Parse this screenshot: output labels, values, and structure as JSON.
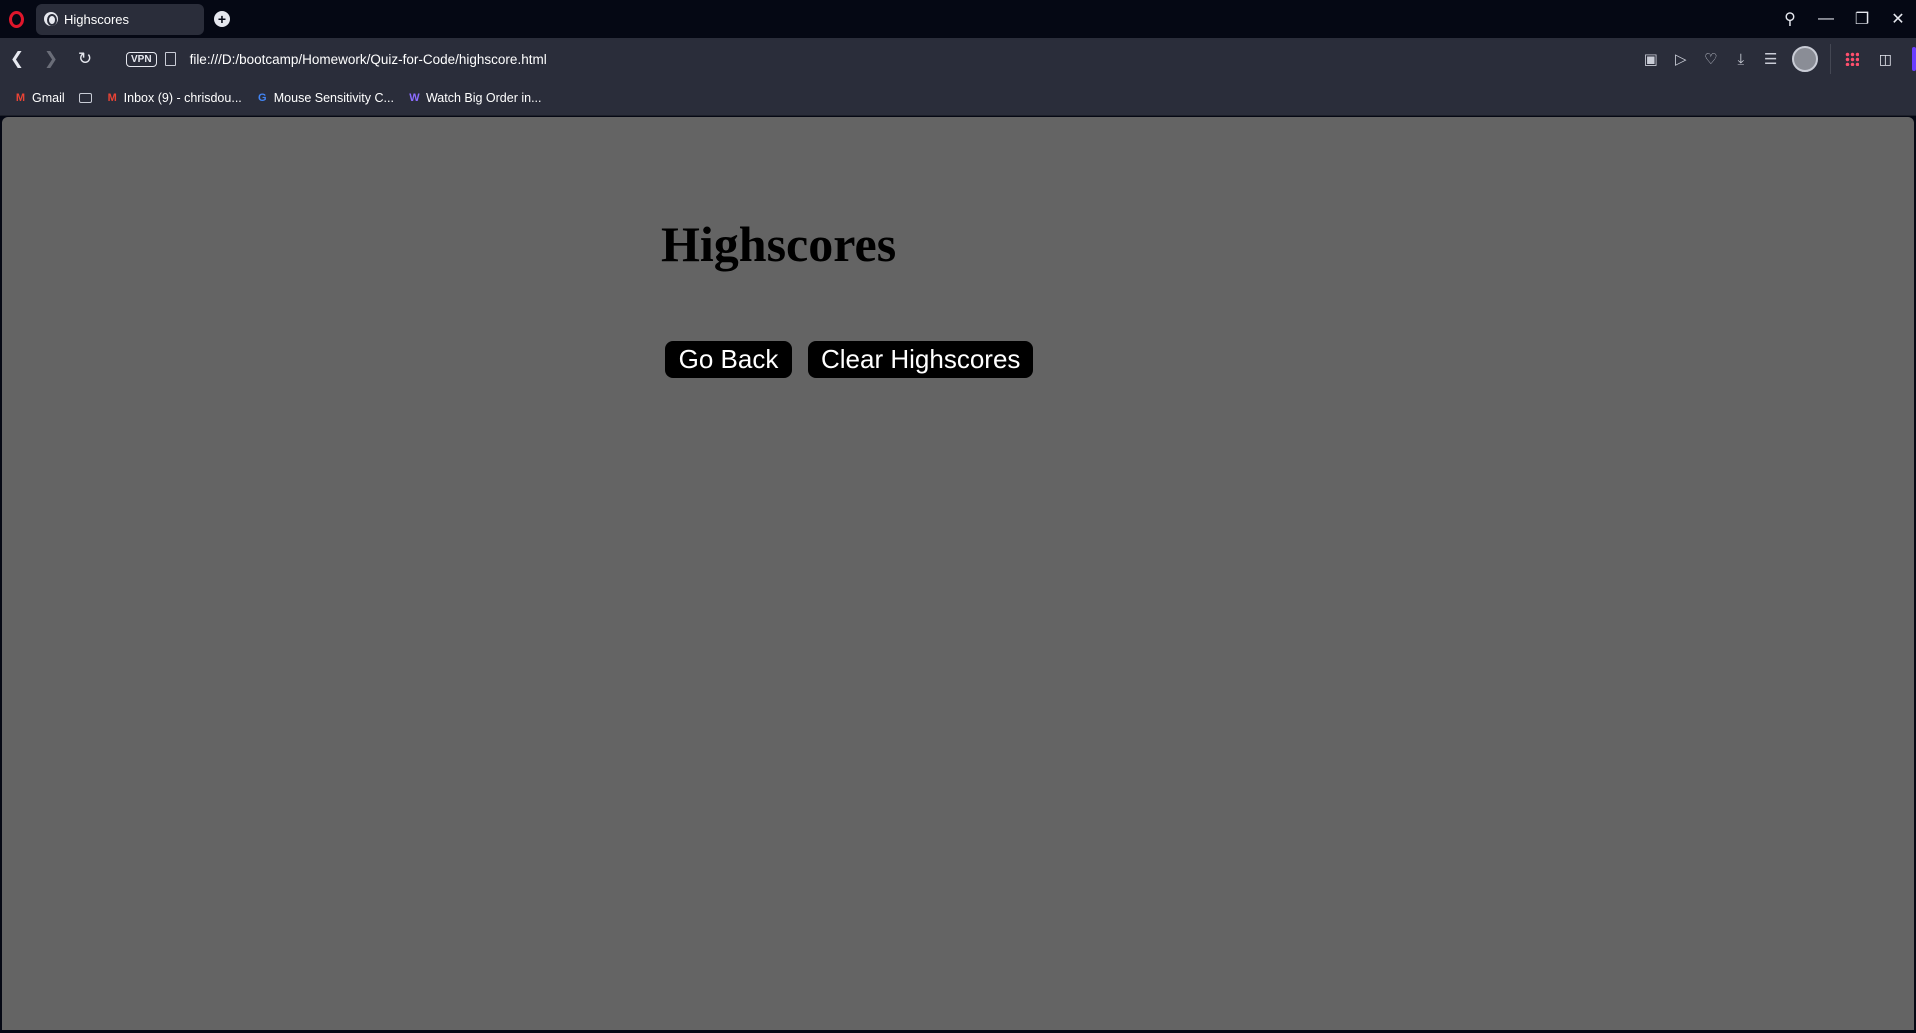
{
  "browser": {
    "tab": {
      "title": "Highscores"
    },
    "address_bar": {
      "vpn_label": "VPN",
      "url": "file:///D:/bootcamp/Homework/Quiz-for-Code/highscore.html"
    },
    "bookmarks": [
      {
        "label": "Gmail",
        "icon": "gmail-icon"
      },
      {
        "label": "",
        "icon": "folder-icon"
      },
      {
        "label": "Inbox (9) - chrisdou...",
        "icon": "gmail-icon"
      },
      {
        "label": "Mouse Sensitivity C...",
        "icon": "google-icon"
      },
      {
        "label": "Watch Big Order in...",
        "icon": "w-icon"
      }
    ],
    "colors": {
      "chrome_dark": "#050814",
      "toolbar": "#2a2d3a",
      "page_background": "#646464",
      "button_background": "#000000",
      "accent": "#6b3cff",
      "opera_red": "#e0162b"
    }
  },
  "page": {
    "heading": "Highscores",
    "buttons": {
      "go_back": "Go Back",
      "clear": "Clear Highscores"
    }
  }
}
